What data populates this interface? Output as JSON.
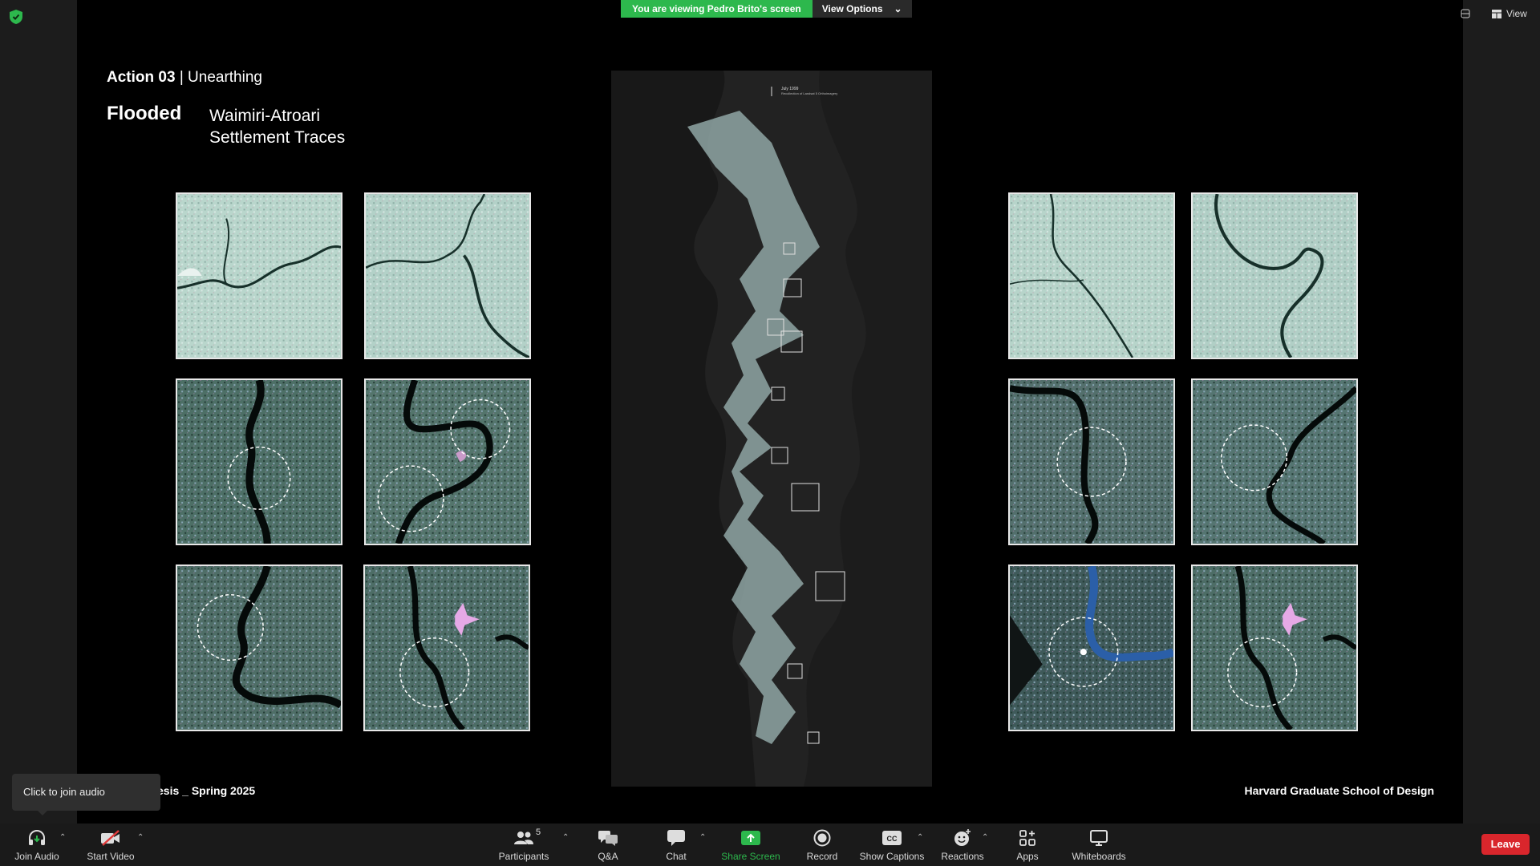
{
  "share_banner": {
    "viewing_text": "You are viewing Pedro Brito's screen",
    "view_options_label": "View Options"
  },
  "top_right": {
    "view_label": "View"
  },
  "slide": {
    "title_bold": "Action 03",
    "title_rest": "| Unearthing",
    "flooded": "Flooded",
    "subtitle_line1": "Waimiri-Atroari",
    "subtitle_line2": "Settlement Traces",
    "footer_left": "esis _ Spring 2025",
    "footer_right": "Harvard Graduate School of Design",
    "center_caption": "July 1999",
    "center_subcaption": "Recollection of Landsat 5 Orthoimagery"
  },
  "tooltip": {
    "text": "Click to join audio"
  },
  "toolbar": {
    "join_audio": "Join Audio",
    "start_video": "Start Video",
    "participants": "Participants",
    "participants_count": "5",
    "qa": "Q&A",
    "chat": "Chat",
    "share_screen": "Share Screen",
    "record": "Record",
    "show_captions": "Show Captions",
    "reactions": "Reactions",
    "apps": "Apps",
    "whiteboards": "Whiteboards",
    "leave": "Leave"
  },
  "colors": {
    "green": "#2db84d",
    "leave_red": "#d9262c",
    "toolbar_bg": "#1a1a1a"
  }
}
